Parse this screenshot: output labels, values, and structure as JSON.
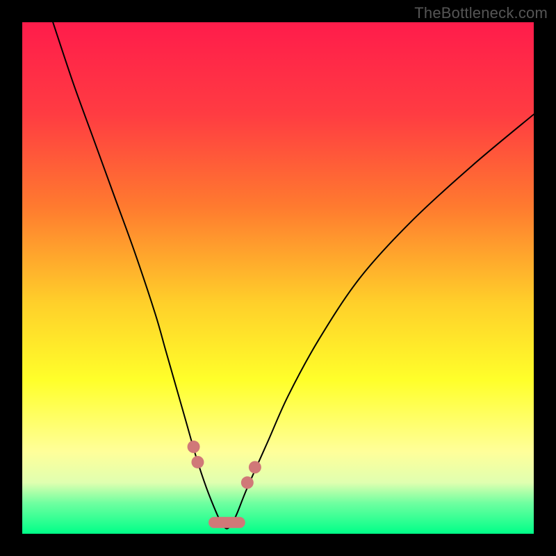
{
  "watermark": "TheBottleneck.com",
  "chart_data": {
    "type": "line",
    "title": "",
    "xlabel": "",
    "ylabel": "",
    "xlim": [
      0,
      100
    ],
    "ylim": [
      0,
      100
    ],
    "grid": false,
    "legend": false,
    "background_gradient": {
      "stops": [
        {
          "t": 0.0,
          "color": "#ff1c4b"
        },
        {
          "t": 0.18,
          "color": "#ff3c42"
        },
        {
          "t": 0.36,
          "color": "#ff7a2f"
        },
        {
          "t": 0.55,
          "color": "#ffd02a"
        },
        {
          "t": 0.7,
          "color": "#ffff2a"
        },
        {
          "t": 0.84,
          "color": "#ffff9a"
        },
        {
          "t": 0.9,
          "color": "#e0ffb0"
        },
        {
          "t": 0.94,
          "color": "#6fffa0"
        },
        {
          "t": 1.0,
          "color": "#00ff88"
        }
      ]
    },
    "series": [
      {
        "name": "bottleneck-curve",
        "color": "#000000",
        "width": 2,
        "x": [
          6,
          10,
          14,
          18,
          22,
          26,
          28,
          30,
          32,
          34,
          36,
          38,
          39,
          40,
          41,
          42,
          44,
          48,
          52,
          58,
          66,
          76,
          88,
          100
        ],
        "y": [
          100,
          88,
          77,
          66,
          55,
          43,
          36,
          29,
          22,
          15,
          9,
          4,
          2,
          1,
          2,
          4,
          9,
          18,
          27,
          38,
          50,
          61,
          72,
          82
        ]
      }
    ],
    "markers": {
      "name": "highlight-markers",
      "color": "#d07878",
      "radius_primary": 9,
      "radius_capsule": 8,
      "points": [
        {
          "x": 33.5,
          "y": 17
        },
        {
          "x": 34.3,
          "y": 14
        },
        {
          "x": 44.0,
          "y": 10
        },
        {
          "x": 45.5,
          "y": 13
        }
      ],
      "bottom_capsule": {
        "x0": 37.5,
        "x1": 42.5,
        "y": 2.2
      }
    }
  }
}
